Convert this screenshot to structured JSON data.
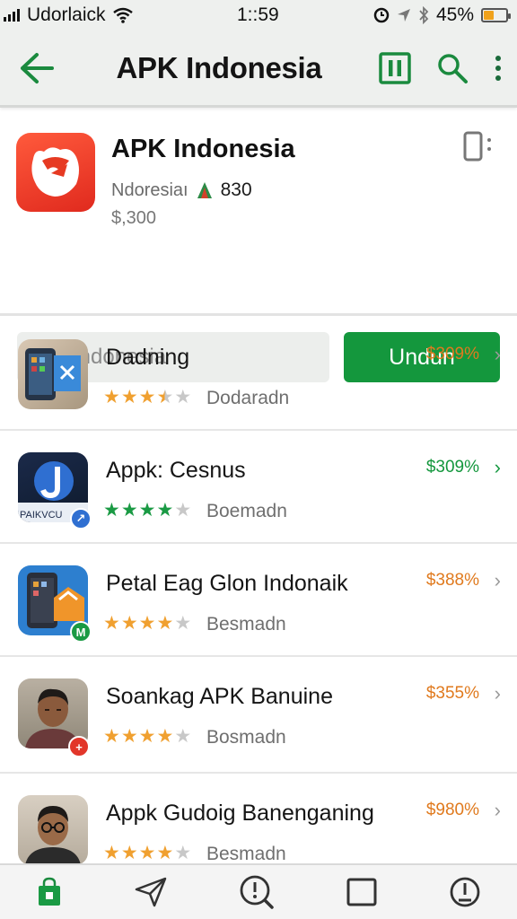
{
  "status_bar": {
    "carrier": "Udorlaick",
    "time": "1::59",
    "battery": "45%",
    "battery_level": 0.45
  },
  "app_bar": {
    "title": "APK Indonesia",
    "icons": [
      "back-arrow-icon",
      "pause-icon",
      "search-icon",
      "more-vert-icon"
    ]
  },
  "header": {
    "app_name": "APK Indonesia",
    "developer": "Ndoresiaı",
    "rating_text": "830",
    "price": "$,300",
    "search_placeholder": "Indonesia",
    "install_label": "Undun"
  },
  "colors": {
    "accent_green": "#14973d",
    "price_orange": "#e07a1e",
    "star_orange": "#f0a030",
    "star_green": "#1a9a44",
    "star_empty": "#c8c8c8"
  },
  "list": [
    {
      "name": "Dadning",
      "developer": "Dodaradn",
      "price": "$309%",
      "price_color": "orange",
      "rating": 3.5,
      "star_color": "orange",
      "thumb": "phone-app-thumbnail"
    },
    {
      "name": "Appk: Cesnus",
      "developer": "Boemadn",
      "price": "$309%",
      "price_color": "green",
      "rating": 4,
      "star_color": "green",
      "thumb": "j-logo-thumbnail",
      "thumb_label": "PAIKVCU"
    },
    {
      "name": "Petal Eag Glon Indonaik",
      "developer": "Besmadn",
      "price": "$388%",
      "price_color": "orange",
      "rating": 4,
      "star_color": "orange",
      "thumb": "phone-app-thumbnail"
    },
    {
      "name": "Soankag APK Banuine",
      "developer": "Bosmadn",
      "price": "$355%",
      "price_color": "orange",
      "rating": 4,
      "star_color": "orange",
      "thumb": "person-photo-thumbnail"
    },
    {
      "name": "Appk Gudoig Banenganing",
      "developer": "Besmadn",
      "price": "$980%",
      "price_color": "orange",
      "rating": 4,
      "star_color": "orange",
      "thumb": "person-glasses-thumbnail"
    }
  ],
  "bottom_nav": [
    "store-bag-icon",
    "send-icon",
    "search-info-icon",
    "square-icon",
    "alert-circle-icon"
  ]
}
